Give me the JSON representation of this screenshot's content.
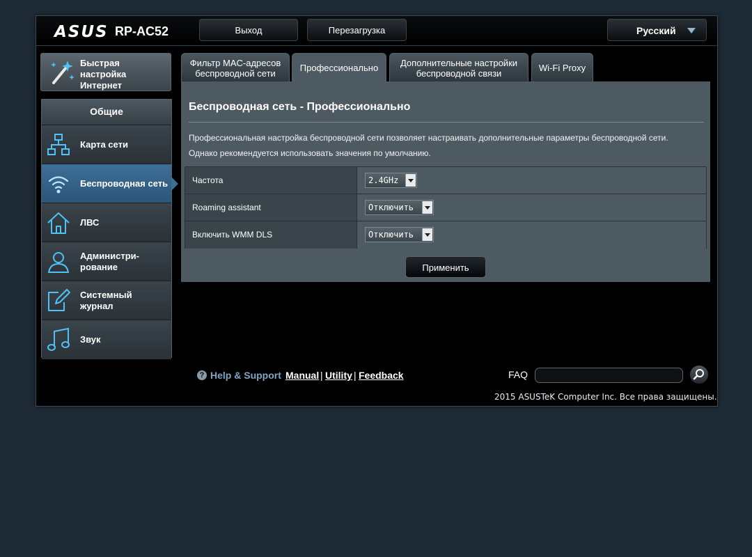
{
  "header": {
    "logo": "ASUS",
    "model": "RP-AC52",
    "logout_label": "Выход",
    "reboot_label": "Перезагрузка",
    "language": "Русский"
  },
  "sidebar": {
    "quick_setup": {
      "line1": "Быстрая",
      "line2": "настройка",
      "line3": "Интернет"
    },
    "section_title": "Общие",
    "items": [
      {
        "line1": "Карта сети",
        "line2": "",
        "icon": "network-map-icon"
      },
      {
        "line1": "Беспроводная сеть",
        "line2": "",
        "icon": "wifi-icon",
        "active": true
      },
      {
        "line1": "ЛВС",
        "line2": "",
        "icon": "home-icon"
      },
      {
        "line1": "Администри-",
        "line2": "рование",
        "icon": "user-icon"
      },
      {
        "line1": "Системный",
        "line2": "журнал",
        "icon": "log-edit-icon"
      },
      {
        "line1": "Звук",
        "line2": "",
        "icon": "music-note-icon"
      }
    ]
  },
  "tabs": [
    {
      "line1": "Фильтр MAC-адресов",
      "line2": "беспроводной сети"
    },
    {
      "line1": "Профессионально",
      "line2": "",
      "active": true
    },
    {
      "line1": "Дополнительные настройки",
      "line2": "беспроводной связи"
    },
    {
      "line1": "Wi-Fi Proxy",
      "line2": ""
    }
  ],
  "panel": {
    "title": "Беспроводная сеть - Профессионально",
    "desc1": "Профессиональная настройка беспроводной сети позволяет настраивать дополнительные параметры беспроводной сети.",
    "desc2": "Однако рекомендуется использовать значения по умолчанию.",
    "rows": [
      {
        "label": "Частота",
        "value": "2.4GHz"
      },
      {
        "label": "Roaming assistant",
        "value": "Отключить"
      },
      {
        "label": "Включить WMM DLS",
        "value": "Отключить"
      }
    ],
    "apply_label": "Применить"
  },
  "footer": {
    "help_label": "Help & Support",
    "manual": "Manual",
    "utility": "Utility",
    "feedback": "Feedback",
    "sep": "|",
    "faq_label": "FAQ",
    "faq_value": "",
    "copyright": "2015 ASUSTeK Computer Inc. Все права защищены."
  },
  "colors": {
    "page_bg": "#1e2a35",
    "panel_bg": "#4d5a61",
    "accent_blue": "#3e6f96",
    "icon_cyan": "#4fc3f7",
    "help_link": "#7fa5c2"
  }
}
